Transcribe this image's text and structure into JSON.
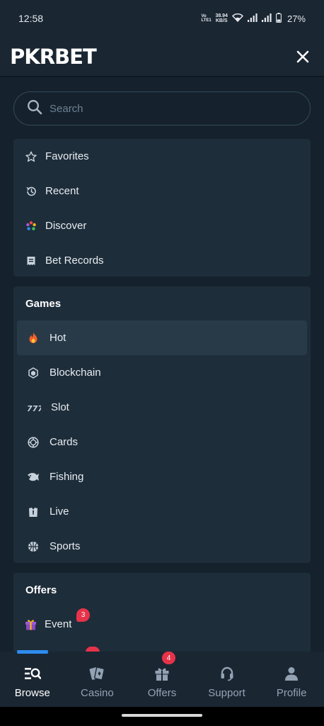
{
  "status_bar": {
    "time": "12:58",
    "volte": "Vo LTE1",
    "net_speed_value": "38.94",
    "net_speed_unit": "KB/S",
    "battery_percent": "27%"
  },
  "header": {
    "logo": "PKRBET"
  },
  "search": {
    "placeholder": "Search"
  },
  "quick_links": [
    {
      "label": "Favorites",
      "icon": "star-icon"
    },
    {
      "label": "Recent",
      "icon": "history-icon"
    },
    {
      "label": "Discover",
      "icon": "discover-icon"
    },
    {
      "label": "Bet Records",
      "icon": "receipt-icon"
    }
  ],
  "games": {
    "title": "Games",
    "items": [
      {
        "label": "Hot",
        "icon": "flame-icon",
        "active": true
      },
      {
        "label": "Blockchain",
        "icon": "blockchain-icon"
      },
      {
        "label": "Slot",
        "icon": "slot-777-icon"
      },
      {
        "label": "Cards",
        "icon": "chip-icon"
      },
      {
        "label": "Fishing",
        "icon": "fish-icon"
      },
      {
        "label": "Live",
        "icon": "live-dealer-icon"
      },
      {
        "label": "Sports",
        "icon": "basketball-icon"
      }
    ]
  },
  "offers": {
    "title": "Offers",
    "items": [
      {
        "label": "Event",
        "icon": "gift-icon",
        "badge": "3"
      }
    ]
  },
  "bottom_nav": [
    {
      "label": "Browse",
      "icon": "browse-icon",
      "active": true
    },
    {
      "label": "Casino",
      "icon": "cards-icon"
    },
    {
      "label": "Offers",
      "icon": "gift-icon",
      "badge": "4"
    },
    {
      "label": "Support",
      "icon": "headset-icon"
    },
    {
      "label": "Profile",
      "icon": "user-icon"
    }
  ],
  "colors": {
    "background": "#15222d",
    "card": "#1e2d3a",
    "header": "#1a2632",
    "active_row": "#283a48",
    "accent_blue": "#2e8cf0",
    "badge_red": "#e6334a",
    "flame_orange": "#f0602a",
    "gift_purple": "#9b59d6"
  }
}
